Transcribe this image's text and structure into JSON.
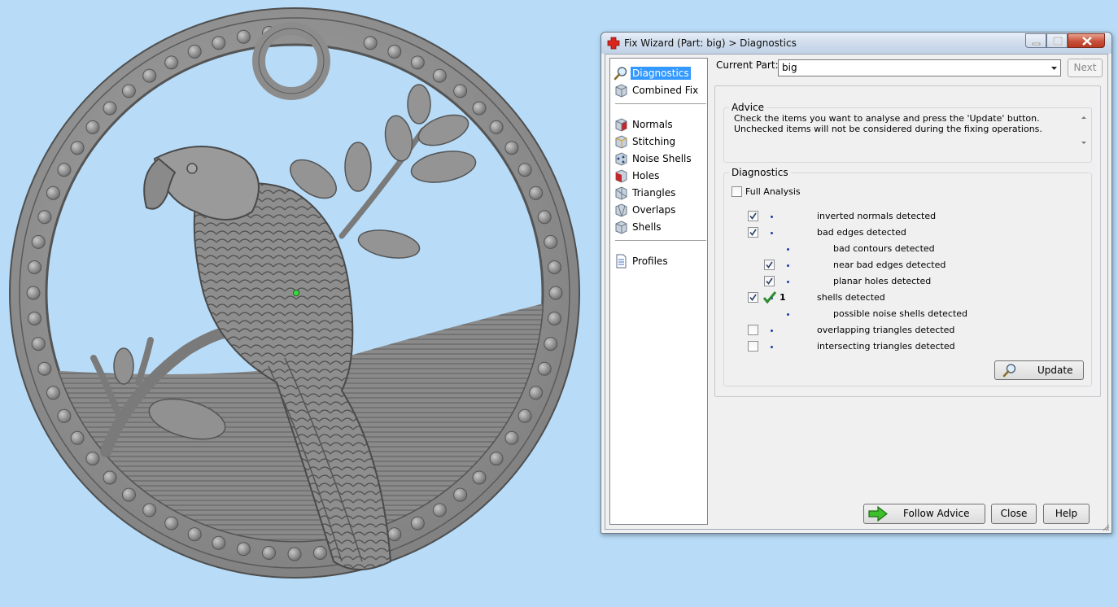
{
  "window": {
    "title": "Fix Wizard (Part: big) > Diagnostics"
  },
  "nav": {
    "items": [
      {
        "label": "Diagnostics",
        "icon": "diagnostics-magnifier-icon",
        "selected": true
      },
      {
        "label": "Combined Fix",
        "icon": "combined-fix-cube-icon"
      },
      {
        "label": "Normals",
        "icon": "normals-cube-icon"
      },
      {
        "label": "Stitching",
        "icon": "stitching-cube-icon"
      },
      {
        "label": "Noise Shells",
        "icon": "noise-shells-cube-icon"
      },
      {
        "label": "Holes",
        "icon": "holes-cube-icon"
      },
      {
        "label": "Triangles",
        "icon": "triangles-cube-icon"
      },
      {
        "label": "Overlaps",
        "icon": "overlaps-cube-icon"
      },
      {
        "label": "Shells",
        "icon": "shells-cube-icon"
      },
      {
        "label": "Profiles",
        "icon": "profiles-document-icon"
      }
    ]
  },
  "part": {
    "label": "Current Part:",
    "value": "big",
    "next_label": "Next"
  },
  "advice": {
    "title": "Advice",
    "text": "Check the items you want to analyse and press the 'Update' button. Unchecked items will not be considered during the fixing operations."
  },
  "diagnostics": {
    "title": "Diagnostics",
    "full_analysis_label": "Full Analysis",
    "full_analysis_checked": false,
    "rows": [
      {
        "label": "inverted normals detected",
        "checked": true,
        "has_checkbox": true,
        "level": 0,
        "result": ""
      },
      {
        "label": "bad edges detected",
        "checked": true,
        "has_checkbox": true,
        "level": 0,
        "result": ""
      },
      {
        "label": "bad contours detected",
        "checked": false,
        "has_checkbox": false,
        "level": 1,
        "result": ""
      },
      {
        "label": "near bad edges detected",
        "checked": true,
        "has_checkbox": true,
        "level": 1,
        "result": ""
      },
      {
        "label": "planar holes detected",
        "checked": true,
        "has_checkbox": true,
        "level": 1,
        "result": ""
      },
      {
        "label": "shells detected",
        "checked": true,
        "has_checkbox": true,
        "level": 0,
        "result": "1"
      },
      {
        "label": "possible noise shells detected",
        "checked": false,
        "has_checkbox": false,
        "level": 1,
        "result": ""
      },
      {
        "label": "overlapping triangles detected",
        "checked": false,
        "has_checkbox": true,
        "level": 0,
        "result": ""
      },
      {
        "label": "intersecting triangles detected",
        "checked": false,
        "has_checkbox": true,
        "level": 0,
        "result": ""
      }
    ],
    "update_label": "Update"
  },
  "footer": {
    "follow_advice_label": "Follow Advice",
    "close_label": "Close",
    "help_label": "Help"
  },
  "colors": {
    "background": "#b8dcf8",
    "model": "#8c8c8c",
    "selection": "#3399ff",
    "check_ok": "#2e8b2e"
  }
}
